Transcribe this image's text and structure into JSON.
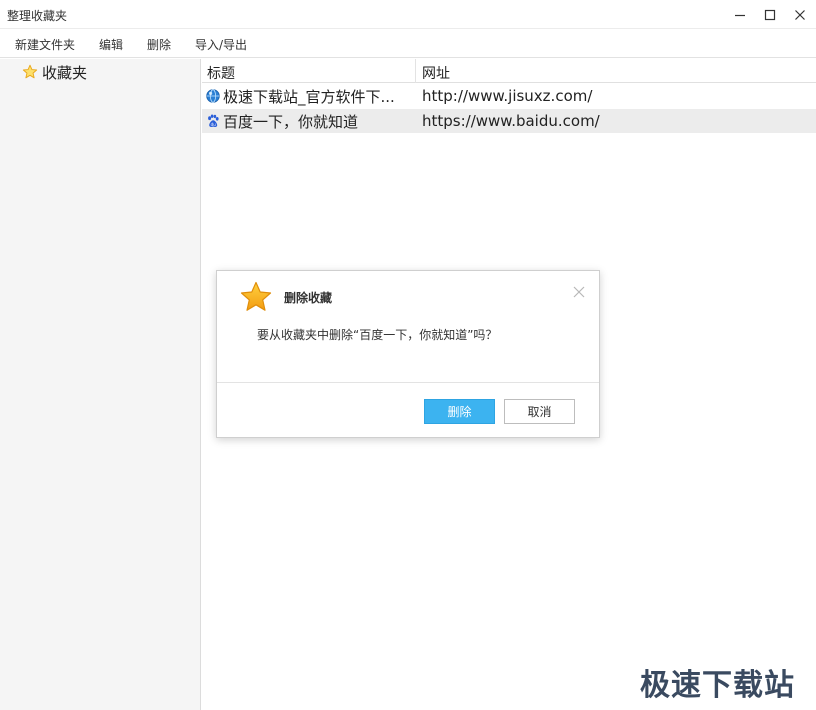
{
  "window": {
    "title": "整理收藏夹",
    "buttons": {
      "minimize": "minimize-icon",
      "maximize": "maximize-icon",
      "close": "close-icon"
    }
  },
  "menubar": {
    "items": [
      "新建文件夹",
      "编辑",
      "删除",
      "导入/导出"
    ]
  },
  "sidebar": {
    "folder": {
      "label": "收藏夹",
      "icon": "star-icon"
    }
  },
  "table": {
    "columns": [
      "标题",
      "网址"
    ],
    "rows": [
      {
        "title": "极速下载站_官方软件下...",
        "url": "http://www.jisuxz.com/",
        "icon": "globe-icon",
        "selected": false
      },
      {
        "title": "百度一下，你就知道",
        "url": "https://www.baidu.com/",
        "icon": "baidu-paw-icon",
        "selected": true
      }
    ]
  },
  "dialog": {
    "title": "删除收藏",
    "message": "要从收藏夹中删除“百度一下，你就知道”吗？",
    "confirm_label": "删除",
    "cancel_label": "取消",
    "icon": "star-icon"
  },
  "colors": {
    "primary_button": "#3cb3f0",
    "star": "#f7a928",
    "selected_row": "#ececec",
    "sidebar_bg": "#f5f5f5"
  },
  "watermark": "极速下载站"
}
